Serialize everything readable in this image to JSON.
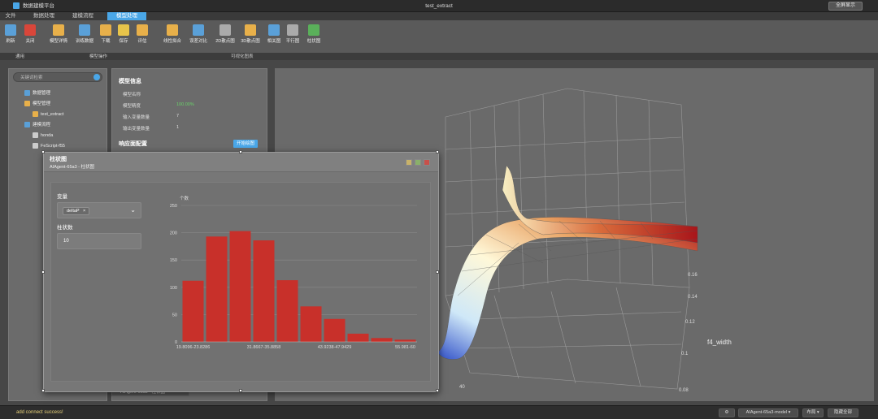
{
  "titlebar": {
    "app_name": "数据建模平台",
    "window_title": "test_extract",
    "fullscreen_label": "全屏显示"
  },
  "menu": {
    "items": [
      {
        "label": "文件",
        "active": false
      },
      {
        "label": "数据处理",
        "active": false
      },
      {
        "label": "建模流程",
        "active": false
      },
      {
        "label": "模型处理",
        "active": true
      }
    ]
  },
  "toolbar": {
    "buttons": [
      {
        "label": "刷新",
        "icon": "refresh-icon",
        "color": "#5aa0d8"
      },
      {
        "label": "关闭",
        "icon": "close-icon",
        "color": "#d9463a"
      },
      {
        "label": "模型详情",
        "icon": "model-detail-icon",
        "color": "#e8b04a"
      },
      {
        "label": "训练数据",
        "icon": "train-data-icon",
        "color": "#5aa0d8"
      },
      {
        "label": "下载",
        "icon": "download-icon",
        "color": "#e8b04a"
      },
      {
        "label": "保存",
        "icon": "save-icon",
        "color": "#e8c44a"
      },
      {
        "label": "评估",
        "icon": "evaluate-icon",
        "color": "#e8b04a"
      },
      {
        "label": "线性拟合",
        "icon": "linear-fit-icon",
        "color": "#e8b04a"
      },
      {
        "label": "误差对比",
        "icon": "error-compare-icon",
        "color": "#5aa0d8"
      },
      {
        "label": "2D散点图",
        "icon": "scatter-2d-icon",
        "color": "#aaaaaa"
      },
      {
        "label": "3D散点图",
        "icon": "scatter-3d-icon",
        "color": "#e8b04a"
      },
      {
        "label": "相关图",
        "icon": "correlation-icon",
        "color": "#5aa0d8"
      },
      {
        "label": "平行图",
        "icon": "parallel-icon",
        "color": "#aaaaaa"
      },
      {
        "label": "柱状图",
        "icon": "bar-chart-icon",
        "color": "#5ab05a"
      }
    ],
    "groups": [
      "通用",
      "模型操作",
      "可视化图表"
    ]
  },
  "sidebar": {
    "search_placeholder": "关键词检索",
    "tree": [
      {
        "label": "数据管理",
        "icon": "database-icon",
        "color": "#5aa0d8"
      },
      {
        "label": "模型管理",
        "icon": "folder-icon",
        "color": "#e8b04a"
      },
      {
        "label": "test_extract",
        "icon": "model-icon",
        "color": "#e8b04a"
      },
      {
        "label": "建模流程",
        "icon": "flow-icon",
        "color": "#5aa0d8"
      },
      {
        "label": "honda",
        "icon": "doc-icon",
        "color": "#cccccc"
      },
      {
        "label": "FeScript-f55",
        "icon": "script-icon",
        "color": "#cccccc"
      }
    ]
  },
  "model_info": {
    "title": "模型信息",
    "rows": [
      {
        "key": "模型名称",
        "value": ""
      },
      {
        "key": "模型精度",
        "value": "100.00%"
      },
      {
        "key": "输入变量数量",
        "value": "7"
      },
      {
        "key": "输出变量数量",
        "value": "1"
      }
    ],
    "section2_title": "响应面配置",
    "start_button": "开始绘图"
  },
  "dialog": {
    "title": "柱状图",
    "subtitle": "AIAgent-65a3 - 柱状图",
    "variable_label": "变量",
    "variable_tag": "deltaP",
    "bins_label": "柱状数",
    "bins_value": "10"
  },
  "chart_data": {
    "type": "bar",
    "ylabel": "个数",
    "xlabel": "deltaP",
    "ylim": [
      0,
      250
    ],
    "yticks": [
      0,
      50,
      100,
      150,
      200,
      250
    ],
    "values": [
      112,
      193,
      203,
      186,
      113,
      65,
      42,
      15,
      7,
      4
    ],
    "xtick_labels": [
      "19.8096-23.8286",
      "31.8667-35.8858",
      "43.9238-47.9429",
      "55.981-60"
    ],
    "bar_color": "#c8302a"
  },
  "surface": {
    "axis_label": "f4_width",
    "ticks": [
      "0.16",
      "0.14",
      "0.12",
      "0.1",
      "0.08"
    ],
    "bottom_tick": "40"
  },
  "bottom_tab": {
    "label": "AIAgent-65a3 - 柱状图"
  },
  "statusbar": {
    "message": "add connect success!",
    "model_select": "AIAgent-65a3-model ▾",
    "layout_select": "布局 ▾",
    "hide_all": "隐藏全部"
  }
}
